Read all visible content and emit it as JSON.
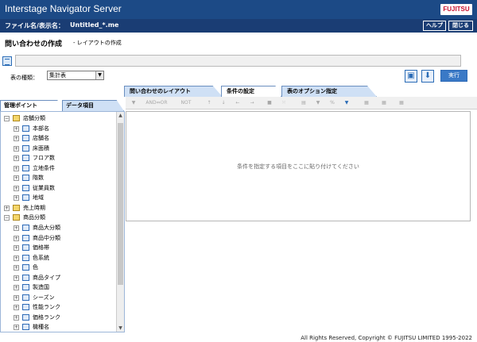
{
  "app": {
    "title": "Interstage Navigator Server",
    "logo": "FUJITSU"
  },
  "filebar": {
    "label": "ファイル名/表示名：",
    "value": "Untitled_*.me",
    "help": "ヘルプ",
    "close": "閉じる"
  },
  "header": {
    "title": "問い合わせの作成",
    "subtitle": "- レイアウトの作成"
  },
  "table_type": {
    "label": "表の種類：",
    "value": "集計表"
  },
  "actions": {
    "execute": "実行"
  },
  "top_tabs": [
    "問い合わせのレイアウト",
    "条件の設定",
    "表のオプション指定"
  ],
  "left_tabs": [
    "管理ポイント",
    "データ項目"
  ],
  "toolbar": {
    "and_or": "AND⇔OR",
    "not": "NOT"
  },
  "tree": [
    {
      "label": "店舗分類",
      "level": 0,
      "type": "folder",
      "expanded": true
    },
    {
      "label": "本部名",
      "level": 1,
      "type": "table"
    },
    {
      "label": "店舗名",
      "level": 1,
      "type": "table"
    },
    {
      "label": "床面積",
      "level": 1,
      "type": "table"
    },
    {
      "label": "フロア数",
      "level": 1,
      "type": "table"
    },
    {
      "label": "立地条件",
      "level": 1,
      "type": "table"
    },
    {
      "label": "階数",
      "level": 1,
      "type": "table"
    },
    {
      "label": "従業員数",
      "level": 1,
      "type": "table"
    },
    {
      "label": "地域",
      "level": 1,
      "type": "table"
    },
    {
      "label": "売上時期",
      "level": 0,
      "type": "folder",
      "expanded": false
    },
    {
      "label": "商品分類",
      "level": 0,
      "type": "folder",
      "expanded": true
    },
    {
      "label": "商品大分類",
      "level": 1,
      "type": "table"
    },
    {
      "label": "商品中分類",
      "level": 1,
      "type": "table"
    },
    {
      "label": "価格帯",
      "level": 1,
      "type": "table"
    },
    {
      "label": "色系統",
      "level": 1,
      "type": "table"
    },
    {
      "label": "色",
      "level": 1,
      "type": "table"
    },
    {
      "label": "商品タイプ",
      "level": 1,
      "type": "table"
    },
    {
      "label": "製造国",
      "level": 1,
      "type": "table"
    },
    {
      "label": "シーズン",
      "level": 1,
      "type": "table"
    },
    {
      "label": "性能ランク",
      "level": 1,
      "type": "table"
    },
    {
      "label": "価格ランク",
      "level": 1,
      "type": "table"
    },
    {
      "label": "機種名",
      "level": 1,
      "type": "table"
    }
  ],
  "condition_area": {
    "placeholder": "条件を指定する項目をここに貼り付けてください"
  },
  "footer": {
    "copyright": "All Rights Reserved, Copyright © FUJITSU LIMITED 1995-2022"
  }
}
